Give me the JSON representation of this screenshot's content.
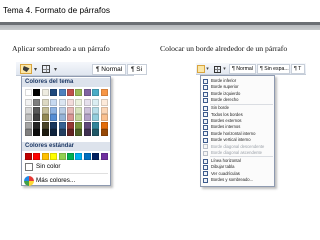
{
  "header": {
    "title": "Tema 4. Formato de párrafos"
  },
  "captions": {
    "left": "Aplicar sombreado a un párrafo",
    "right": "Colocar un borde alrededor de un párrafo"
  },
  "left_toolbar": {
    "style_normal": "¶ Normal",
    "style_next": "¶ Si"
  },
  "color_panel": {
    "theme_colors_label": "Colores del tema",
    "standard_colors_label": "Colores estándar",
    "no_color_label": "Sin color",
    "more_colors_label": "Más colores...",
    "theme_colors": [
      [
        "#ffffff",
        "#000000",
        "#eeece1",
        "#1f497d",
        "#4f81bd",
        "#c0504d",
        "#9bbb59",
        "#8064a2",
        "#4bacc6",
        "#f79646"
      ],
      [
        "#f2f2f2",
        "#7f7f7f",
        "#ddd9c3",
        "#c6d9f0",
        "#dbe5f1",
        "#f2dcdb",
        "#ebf1dd",
        "#e5e0ec",
        "#dbeef3",
        "#fdeada"
      ],
      [
        "#d8d8d8",
        "#595959",
        "#c4bd97",
        "#8db3e2",
        "#b8cce4",
        "#e5b9b7",
        "#d7e3bc",
        "#ccc1d9",
        "#b7dde8",
        "#fbd5b5"
      ],
      [
        "#bfbfbf",
        "#3f3f3f",
        "#938953",
        "#548dd4",
        "#95b3d7",
        "#d99694",
        "#c3d69b",
        "#b2a2c7",
        "#92cddc",
        "#fac08f"
      ],
      [
        "#a5a5a5",
        "#262626",
        "#494429",
        "#17365d",
        "#366092",
        "#953734",
        "#76923c",
        "#5f497a",
        "#31859b",
        "#e36c09"
      ],
      [
        "#7f7f7f",
        "#0c0c0c",
        "#1d1b10",
        "#0f243e",
        "#244061",
        "#632423",
        "#4f6128",
        "#3f3151",
        "#205867",
        "#974806"
      ]
    ],
    "standard_colors": [
      "#c00000",
      "#ff0000",
      "#ffc000",
      "#ffff00",
      "#92d050",
      "#00b050",
      "#00b0f0",
      "#0070c0",
      "#002060",
      "#7030a0"
    ]
  },
  "right_toolbar": {
    "style_normal": "¶ Normal",
    "style_spacing": "¶ Sin espa...",
    "style_other": "¶ T"
  },
  "border_menu": {
    "items": [
      {
        "label": "Borde inferior",
        "disabled": false
      },
      {
        "label": "Borde superior",
        "disabled": false
      },
      {
        "label": "Borde izquierdo",
        "disabled": false
      },
      {
        "label": "Borde derecho",
        "disabled": false
      },
      {
        "label": "Sin borde",
        "disabled": false
      },
      {
        "label": "Todos los bordes",
        "disabled": false
      },
      {
        "label": "Bordes externos",
        "disabled": false
      },
      {
        "label": "Bordes internos",
        "disabled": false
      },
      {
        "label": "Borde horizontal interno",
        "disabled": false
      },
      {
        "label": "Borde vertical interno",
        "disabled": false
      },
      {
        "label": "Borde diagonal descendente",
        "disabled": true
      },
      {
        "label": "Borde diagonal ascendente",
        "disabled": true
      },
      {
        "label": "Línea horizontal",
        "disabled": false
      },
      {
        "label": "Dibujar tabla",
        "disabled": false
      },
      {
        "label": "Ver cuadrículas",
        "disabled": false
      },
      {
        "label": "Bordes y sombreado...",
        "disabled": false
      }
    ]
  }
}
